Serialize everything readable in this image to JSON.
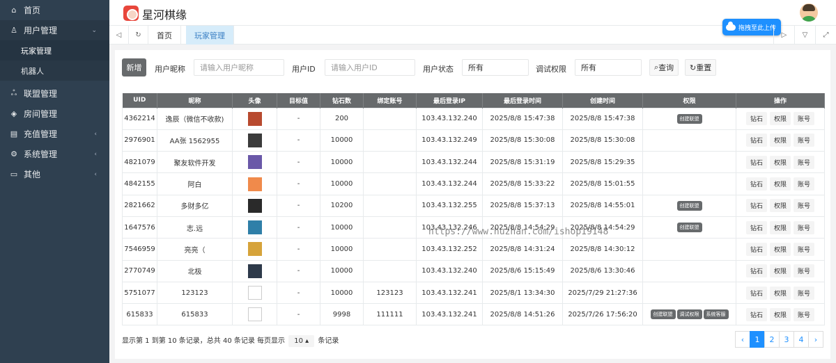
{
  "sidebar": {
    "home": "首页",
    "user_mgmt": "用户管理",
    "player_mgmt": "玩家管理",
    "robot": "机器人",
    "league_mgmt": "联盟管理",
    "room_mgmt": "房间管理",
    "recharge_mgmt": "充值管理",
    "system_mgmt": "系统管理",
    "other": "其他"
  },
  "header": {
    "title": "星河棋缘"
  },
  "tabs": {
    "home": "首页",
    "players": "玩家管理"
  },
  "upload_badge": "拖拽至此上传",
  "filters": {
    "new_button": "新增",
    "nickname_label": "用户昵称",
    "nickname_placeholder": "请输入用户昵称",
    "uid_label": "用户ID",
    "uid_placeholder": "请输入用户ID",
    "status_label": "用户状态",
    "status_value": "所有",
    "debug_label": "调试权限",
    "debug_value": "所有",
    "query_button": "查询",
    "reset_button": "重置"
  },
  "table": {
    "headers": [
      "UID",
      "昵称",
      "头像",
      "目标值",
      "钻石数",
      "绑定账号",
      "最后登录IP",
      "最后登录时间",
      "创建时间",
      "权限",
      "操作"
    ],
    "actions": [
      "钻石",
      "权限",
      "账号"
    ],
    "rows": [
      {
        "uid": "4362214",
        "nick": "逸辰（微信不收款)",
        "avatar": "#b84a2f",
        "target": "-",
        "diamonds": "200",
        "bind": "",
        "ip": "103.43.132.240",
        "last": "2025/8/8 15:47:38",
        "created": "2025/8/8 15:47:38",
        "perms": [
          "创建联盟"
        ]
      },
      {
        "uid": "2976901",
        "nick": "AA张 1562955",
        "avatar": "#3b3b3b",
        "target": "-",
        "diamonds": "10000",
        "bind": "",
        "ip": "103.43.132.249",
        "last": "2025/8/8 15:30:08",
        "created": "2025/8/8 15:30:08",
        "perms": []
      },
      {
        "uid": "4821079",
        "nick": "聚友软件开发",
        "avatar": "#6a58a8",
        "target": "-",
        "diamonds": "10000",
        "bind": "",
        "ip": "103.43.132.244",
        "last": "2025/8/8 15:31:19",
        "created": "2025/8/8 15:29:35",
        "perms": []
      },
      {
        "uid": "4842155",
        "nick": "阿白",
        "avatar": "#f08a4b",
        "target": "-",
        "diamonds": "10000",
        "bind": "",
        "ip": "103.43.132.244",
        "last": "2025/8/8 15:33:22",
        "created": "2025/8/8 15:01:55",
        "perms": []
      },
      {
        "uid": "2821662",
        "nick": "多财多亿",
        "avatar": "#2a2a2a",
        "target": "-",
        "diamonds": "10200",
        "bind": "",
        "ip": "103.43.132.255",
        "last": "2025/8/8 15:37:13",
        "created": "2025/8/8 14:55:01",
        "perms": [
          "创建联盟"
        ]
      },
      {
        "uid": "1647576",
        "nick": "志.远",
        "avatar": "#2f7fa8",
        "target": "-",
        "diamonds": "10000",
        "bind": "",
        "ip": "103.43.132.246",
        "last": "2025/8/8 14:54:29",
        "created": "2025/8/8 14:54:29",
        "perms": [
          "创建联盟"
        ]
      },
      {
        "uid": "7546959",
        "nick": "亮亮（",
        "avatar": "#d6a33a",
        "target": "-",
        "diamonds": "10000",
        "bind": "",
        "ip": "103.43.132.252",
        "last": "2025/8/8 14:31:24",
        "created": "2025/8/8 14:30:12",
        "perms": []
      },
      {
        "uid": "2770749",
        "nick": "北极",
        "avatar": "#2e3a4a",
        "target": "-",
        "diamonds": "10000",
        "bind": "",
        "ip": "103.43.132.240",
        "last": "2025/8/6 15:15:49",
        "created": "2025/8/6 13:30:46",
        "perms": []
      },
      {
        "uid": "5751077",
        "nick": "123123",
        "avatar": "",
        "target": "-",
        "diamonds": "10000",
        "bind": "123123",
        "ip": "103.43.132.241",
        "last": "2025/8/1 13:34:30",
        "created": "2025/7/29 21:27:36",
        "perms": []
      },
      {
        "uid": "615833",
        "nick": "615833",
        "avatar": "",
        "target": "-",
        "diamonds": "9998",
        "bind": "111111",
        "ip": "103.43.132.241",
        "last": "2025/8/8 14:51:26",
        "created": "2025/7/26 17:56:20",
        "perms": [
          "创建联盟",
          "调试权限",
          "系统客服"
        ]
      }
    ]
  },
  "pagination": {
    "info_prefix": "显示第 1 到第 10 条记录，总共 40 条记录 每页显示",
    "page_size": "10 ▴",
    "info_suffix": "条记录",
    "prev": "‹",
    "pages": [
      "1",
      "2",
      "3",
      "4"
    ],
    "next": "›"
  },
  "watermark": "https://www.huzhan.com/ishop19148"
}
